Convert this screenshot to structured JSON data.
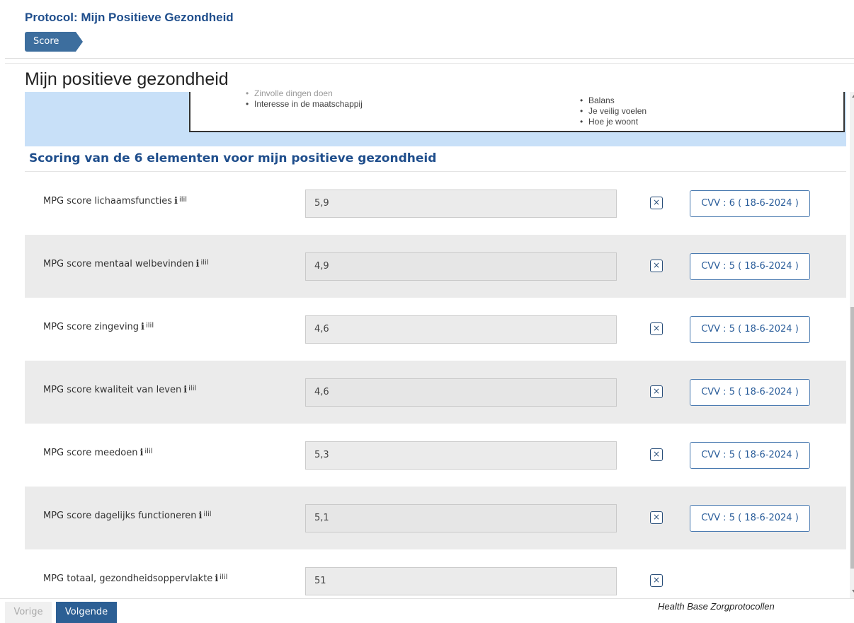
{
  "header": {
    "protocol_title": "Protocol: Mijn Positieve Gezondheid",
    "step_label": "Score"
  },
  "page": {
    "title": "Mijn positieve gezondheid"
  },
  "info_image": {
    "left_items": [
      "Zinvolle dingen doen",
      "Interesse in de maatschappij"
    ],
    "right_items": [
      "Balans",
      "Je veilig voelen",
      "Hoe je woont"
    ]
  },
  "section": {
    "title": "Scoring van de 6 elementen voor mijn positieve gezondheid"
  },
  "rows": [
    {
      "label": "MPG score lichaamsfuncties",
      "value": "5,9",
      "cvv": "CVV : 6 ( 18-6-2024 )"
    },
    {
      "label": "MPG score mentaal welbevinden",
      "value": "4,9",
      "cvv": "CVV : 5 ( 18-6-2024 )"
    },
    {
      "label": "MPG score zingeving",
      "value": "4,6",
      "cvv": "CVV : 5 ( 18-6-2024 )"
    },
    {
      "label": "MPG score kwaliteit van leven",
      "value": "4,6",
      "cvv": "CVV : 5 ( 18-6-2024 )"
    },
    {
      "label": "MPG score meedoen",
      "value": "5,3",
      "cvv": "CVV : 5 ( 18-6-2024 )"
    },
    {
      "label": "MPG score dagelijks functioneren",
      "value": "5,1",
      "cvv": "CVV : 5 ( 18-6-2024 )"
    },
    {
      "label": "MPG totaal, gezondheidsoppervlakte",
      "value": "51",
      "cvv": ""
    }
  ],
  "icons": {
    "info": "i",
    "chart": "ilil",
    "clear": "×"
  },
  "footer": {
    "prev_label": "Vorige",
    "next_label": "Volgende",
    "brand": "Health Base Zorgprotocollen"
  },
  "colors": {
    "brand_blue": "#1f4e8c",
    "primary_button": "#2c5f94",
    "info_band": "#c8e0f8"
  }
}
